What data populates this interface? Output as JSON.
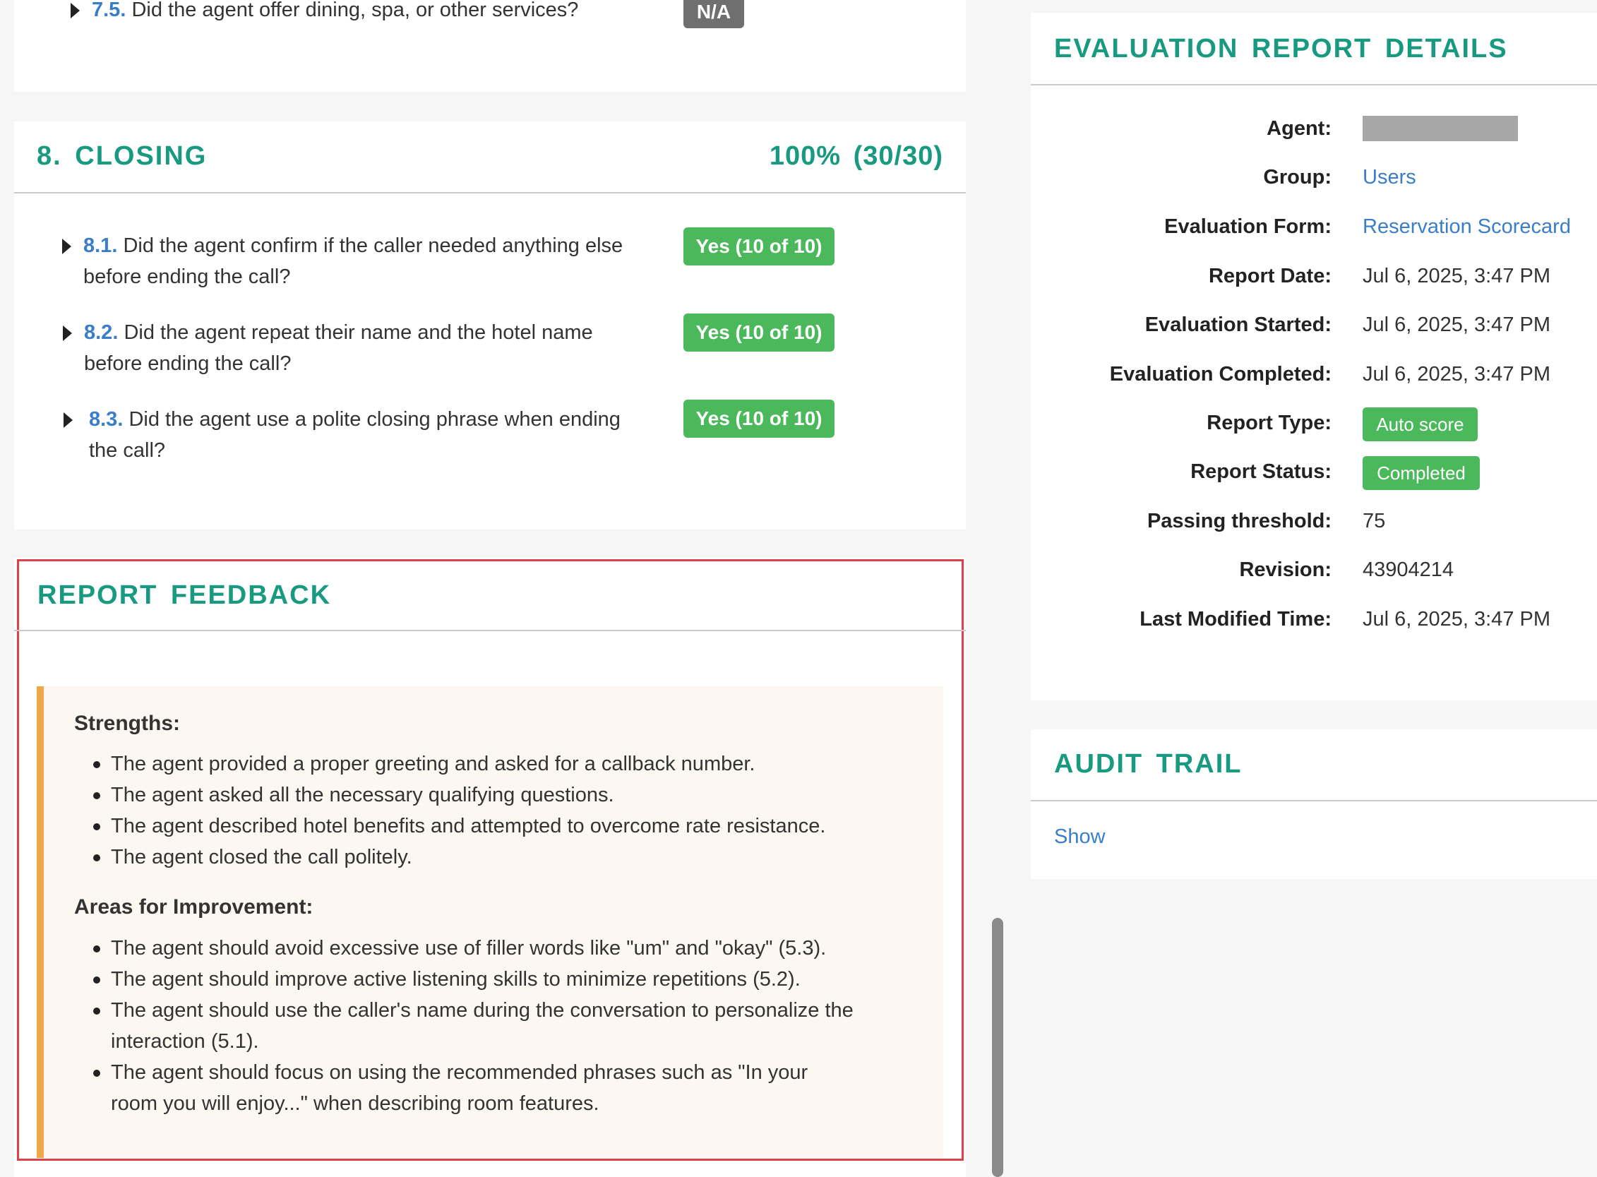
{
  "section7": {
    "item": {
      "number": "7.5.",
      "text": "Did the agent offer dining, spa, or other services?",
      "badge": "N/A"
    }
  },
  "section8": {
    "title": "8. CLOSING",
    "score": "100% (30/30)",
    "items": [
      {
        "number": "8.1.",
        "line1": "Did the agent confirm if the caller needed anything else",
        "line2": "before ending the call?",
        "badge": "Yes (10 of 10)"
      },
      {
        "number": "8.2.",
        "line1": "Did the agent repeat their name and the hotel name",
        "line2": "before ending the call?",
        "badge": "Yes (10 of 10)"
      },
      {
        "number": "8.3.",
        "line1": "Did the agent use a polite closing phrase when ending",
        "line2": "the call?",
        "badge": "Yes (10 of 10)"
      }
    ]
  },
  "feedback": {
    "title": "REPORT FEEDBACK",
    "strengths_heading": "Strengths:",
    "strengths": [
      "The agent provided a proper greeting and asked for a callback number.",
      "The agent asked all the necessary qualifying questions.",
      "The agent described hotel benefits and attempted to overcome rate resistance.",
      "The agent closed the call politely."
    ],
    "improvement_heading": "Areas for Improvement:",
    "improvements": [
      "The agent should avoid excessive use of filler words like \"um\" and \"okay\" (5.3).",
      "The agent should improve active listening skills to minimize repetitions (5.2).",
      "The agent should use the caller's name during the conversation to personalize the",
      "interaction (5.1).",
      "The agent should focus on using the recommended phrases such as \"In your",
      "room you will enjoy...\" when describing room features."
    ]
  },
  "details": {
    "title": "EVALUATION REPORT DETAILS",
    "agent_label": "Agent:",
    "group_label": "Group:",
    "group_value": "Users",
    "form_label": "Evaluation Form:",
    "form_value": "Reservation Scorecard",
    "report_date_label": "Report Date:",
    "report_date_value": "Jul 6, 2025, 3:47 PM",
    "started_label": "Evaluation Started:",
    "started_value": "Jul 6, 2025, 3:47 PM",
    "completed_label": "Evaluation Completed:",
    "completed_value": "Jul 6, 2025, 3:47 PM",
    "type_label": "Report Type:",
    "type_value": "Auto score",
    "status_label": "Report Status:",
    "status_value": "Completed",
    "threshold_label": "Passing threshold:",
    "threshold_value": "75",
    "revision_label": "Revision:",
    "revision_value": "43904214",
    "modified_label": "Last Modified Time:",
    "modified_value": "Jul 6, 2025, 3:47 PM"
  },
  "audit": {
    "title": "AUDIT TRAIL",
    "show_label": "Show"
  },
  "colors": {
    "section_title": "#179a7f",
    "link": "#3a7dc9",
    "badge_green": "#4cb85c",
    "badge_gray": "#6f6f6f",
    "feedback_border": "#e0404a",
    "feedback_accent": "#eea84a"
  }
}
